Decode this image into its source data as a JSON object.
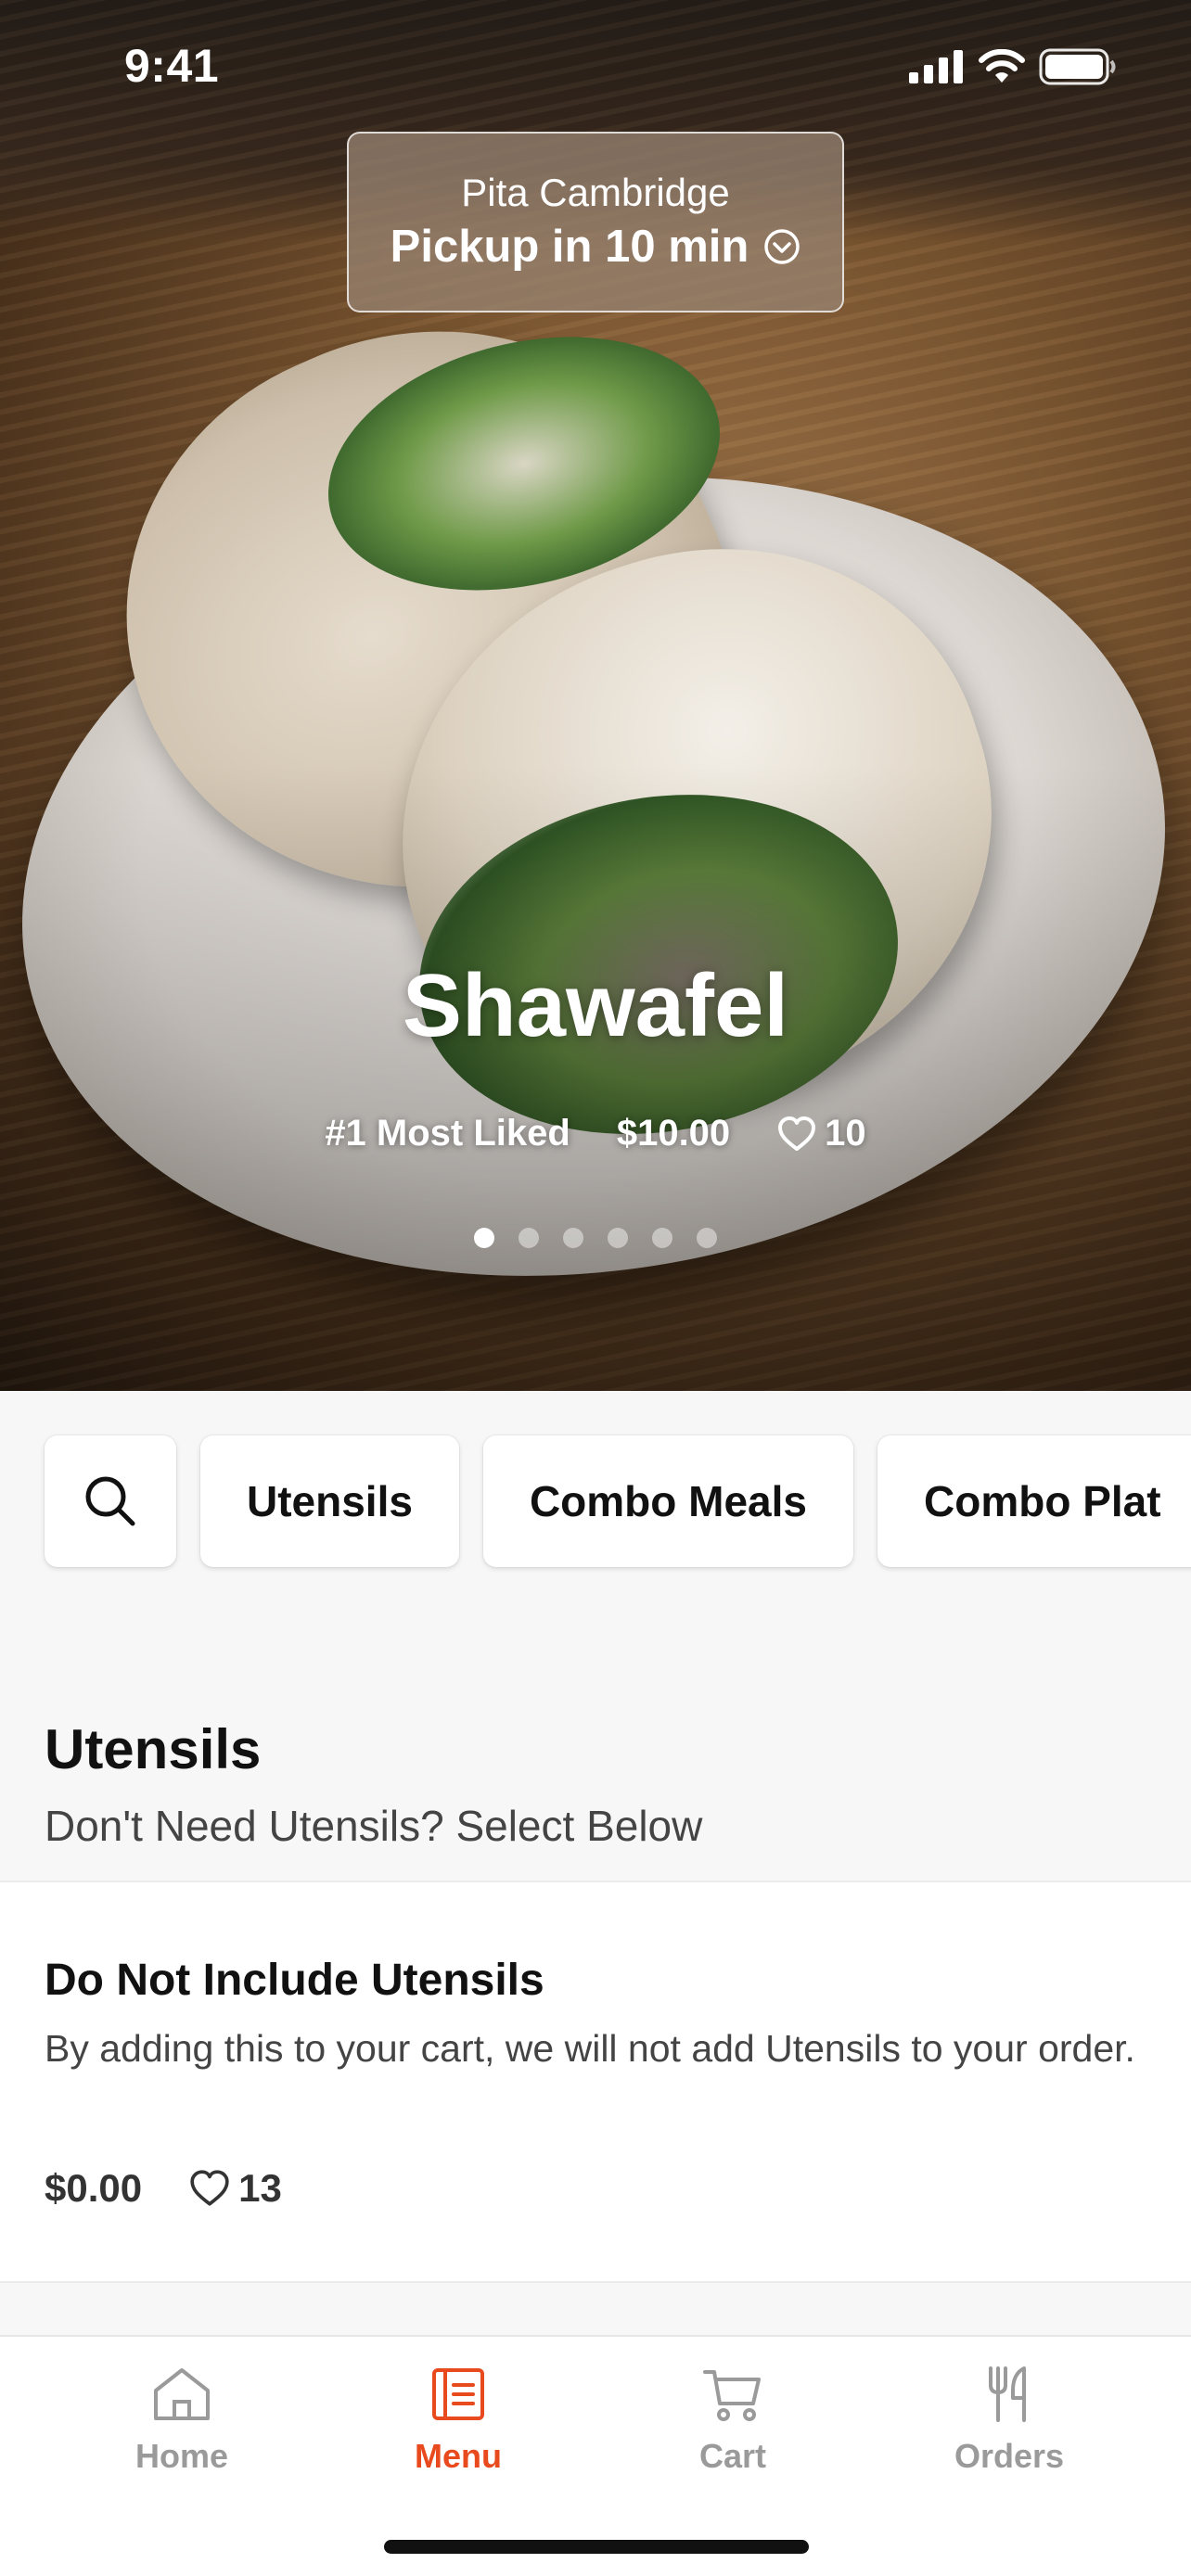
{
  "status_bar": {
    "time": "9:41"
  },
  "pickup": {
    "store": "Pita Cambridge",
    "time": "Pickup in 10 min"
  },
  "hero": {
    "title": "Shawafel",
    "rank": "#1 Most Liked",
    "price": "$10.00",
    "likes": "10",
    "carousel": {
      "count": 6,
      "active_index": 0
    }
  },
  "categories": [
    {
      "label": "Utensils"
    },
    {
      "label": "Combo Meals"
    },
    {
      "label": "Combo Plat"
    }
  ],
  "section": {
    "title": "Utensils",
    "subtitle": "Don't Need Utensils? Select Below"
  },
  "items": [
    {
      "name": "Do Not Include Utensils",
      "description": "By adding this to your cart, we will not add Utensils to your order.",
      "price": "$0.00",
      "likes": "13"
    }
  ],
  "tab_bar": {
    "tabs": [
      {
        "label": "Home",
        "icon": "home-icon",
        "active": false
      },
      {
        "label": "Menu",
        "icon": "menu-icon",
        "active": true
      },
      {
        "label": "Cart",
        "icon": "cart-icon",
        "active": false
      },
      {
        "label": "Orders",
        "icon": "orders-icon",
        "active": false
      }
    ]
  },
  "colors": {
    "accent": "#e8491d",
    "inactive": "#9a9a9a",
    "background": "#f7f7f7"
  }
}
